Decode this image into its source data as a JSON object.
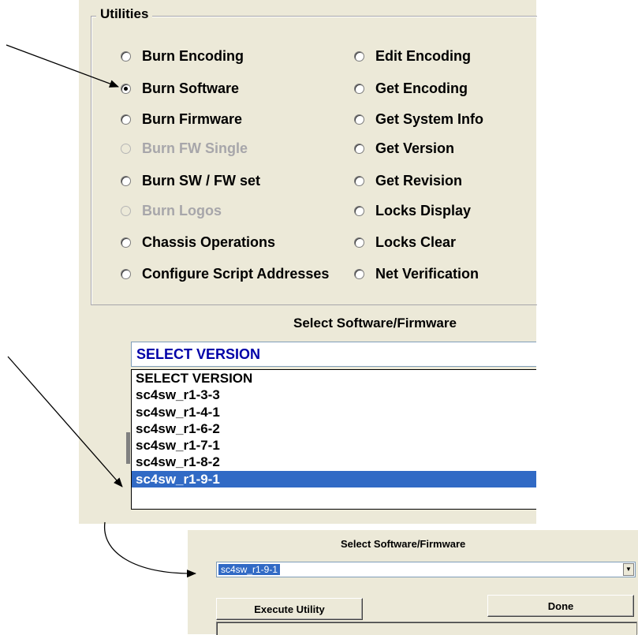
{
  "utilities": {
    "title": "Utilities",
    "left_options": [
      {
        "label": "Burn Encoding",
        "checked": false,
        "disabled": false
      },
      {
        "label": "Burn Software",
        "checked": true,
        "disabled": false
      },
      {
        "label": "Burn Firmware",
        "checked": false,
        "disabled": false
      },
      {
        "label": "Burn FW Single",
        "checked": false,
        "disabled": true
      },
      {
        "label": "Burn SW / FW set",
        "checked": false,
        "disabled": false
      },
      {
        "label": "Burn Logos",
        "checked": false,
        "disabled": true
      },
      {
        "label": "Chassis Operations",
        "checked": false,
        "disabled": false
      },
      {
        "label": "Configure Script Addresses",
        "checked": false,
        "disabled": false
      }
    ],
    "right_options": [
      {
        "label": "Edit Encoding",
        "checked": false,
        "disabled": false
      },
      {
        "label": "Get Encoding",
        "checked": false,
        "disabled": false
      },
      {
        "label": "Get System Info",
        "checked": false,
        "disabled": false
      },
      {
        "label": "Get Version",
        "checked": false,
        "disabled": false
      },
      {
        "label": "Get Revision",
        "checked": false,
        "disabled": false
      },
      {
        "label": "Locks Display",
        "checked": false,
        "disabled": false
      },
      {
        "label": "Locks Clear",
        "checked": false,
        "disabled": false
      },
      {
        "label": "Net Verification",
        "checked": false,
        "disabled": false
      }
    ]
  },
  "software_select": {
    "label": "Select Software/Firmware",
    "current_value": "SELECT VERSION",
    "options": [
      {
        "label": "SELECT VERSION",
        "selected": false
      },
      {
        "label": "sc4sw_r1-3-3",
        "selected": false
      },
      {
        "label": "sc4sw_r1-4-1",
        "selected": false
      },
      {
        "label": "sc4sw_r1-6-2",
        "selected": false
      },
      {
        "label": "sc4sw_r1-7-1",
        "selected": false
      },
      {
        "label": "sc4sw_r1-8-2",
        "selected": false
      },
      {
        "label": "sc4sw_r1-9-1",
        "selected": true
      }
    ]
  },
  "result_panel": {
    "label": "Select Software/Firmware",
    "selected_value": "sc4sw_r1-9-1",
    "execute_label": "Execute Utility",
    "done_label": "Done"
  },
  "colors": {
    "dialog_bg": "#ece9d8",
    "selection": "#316ac5",
    "combo_text": "#0000a8"
  }
}
